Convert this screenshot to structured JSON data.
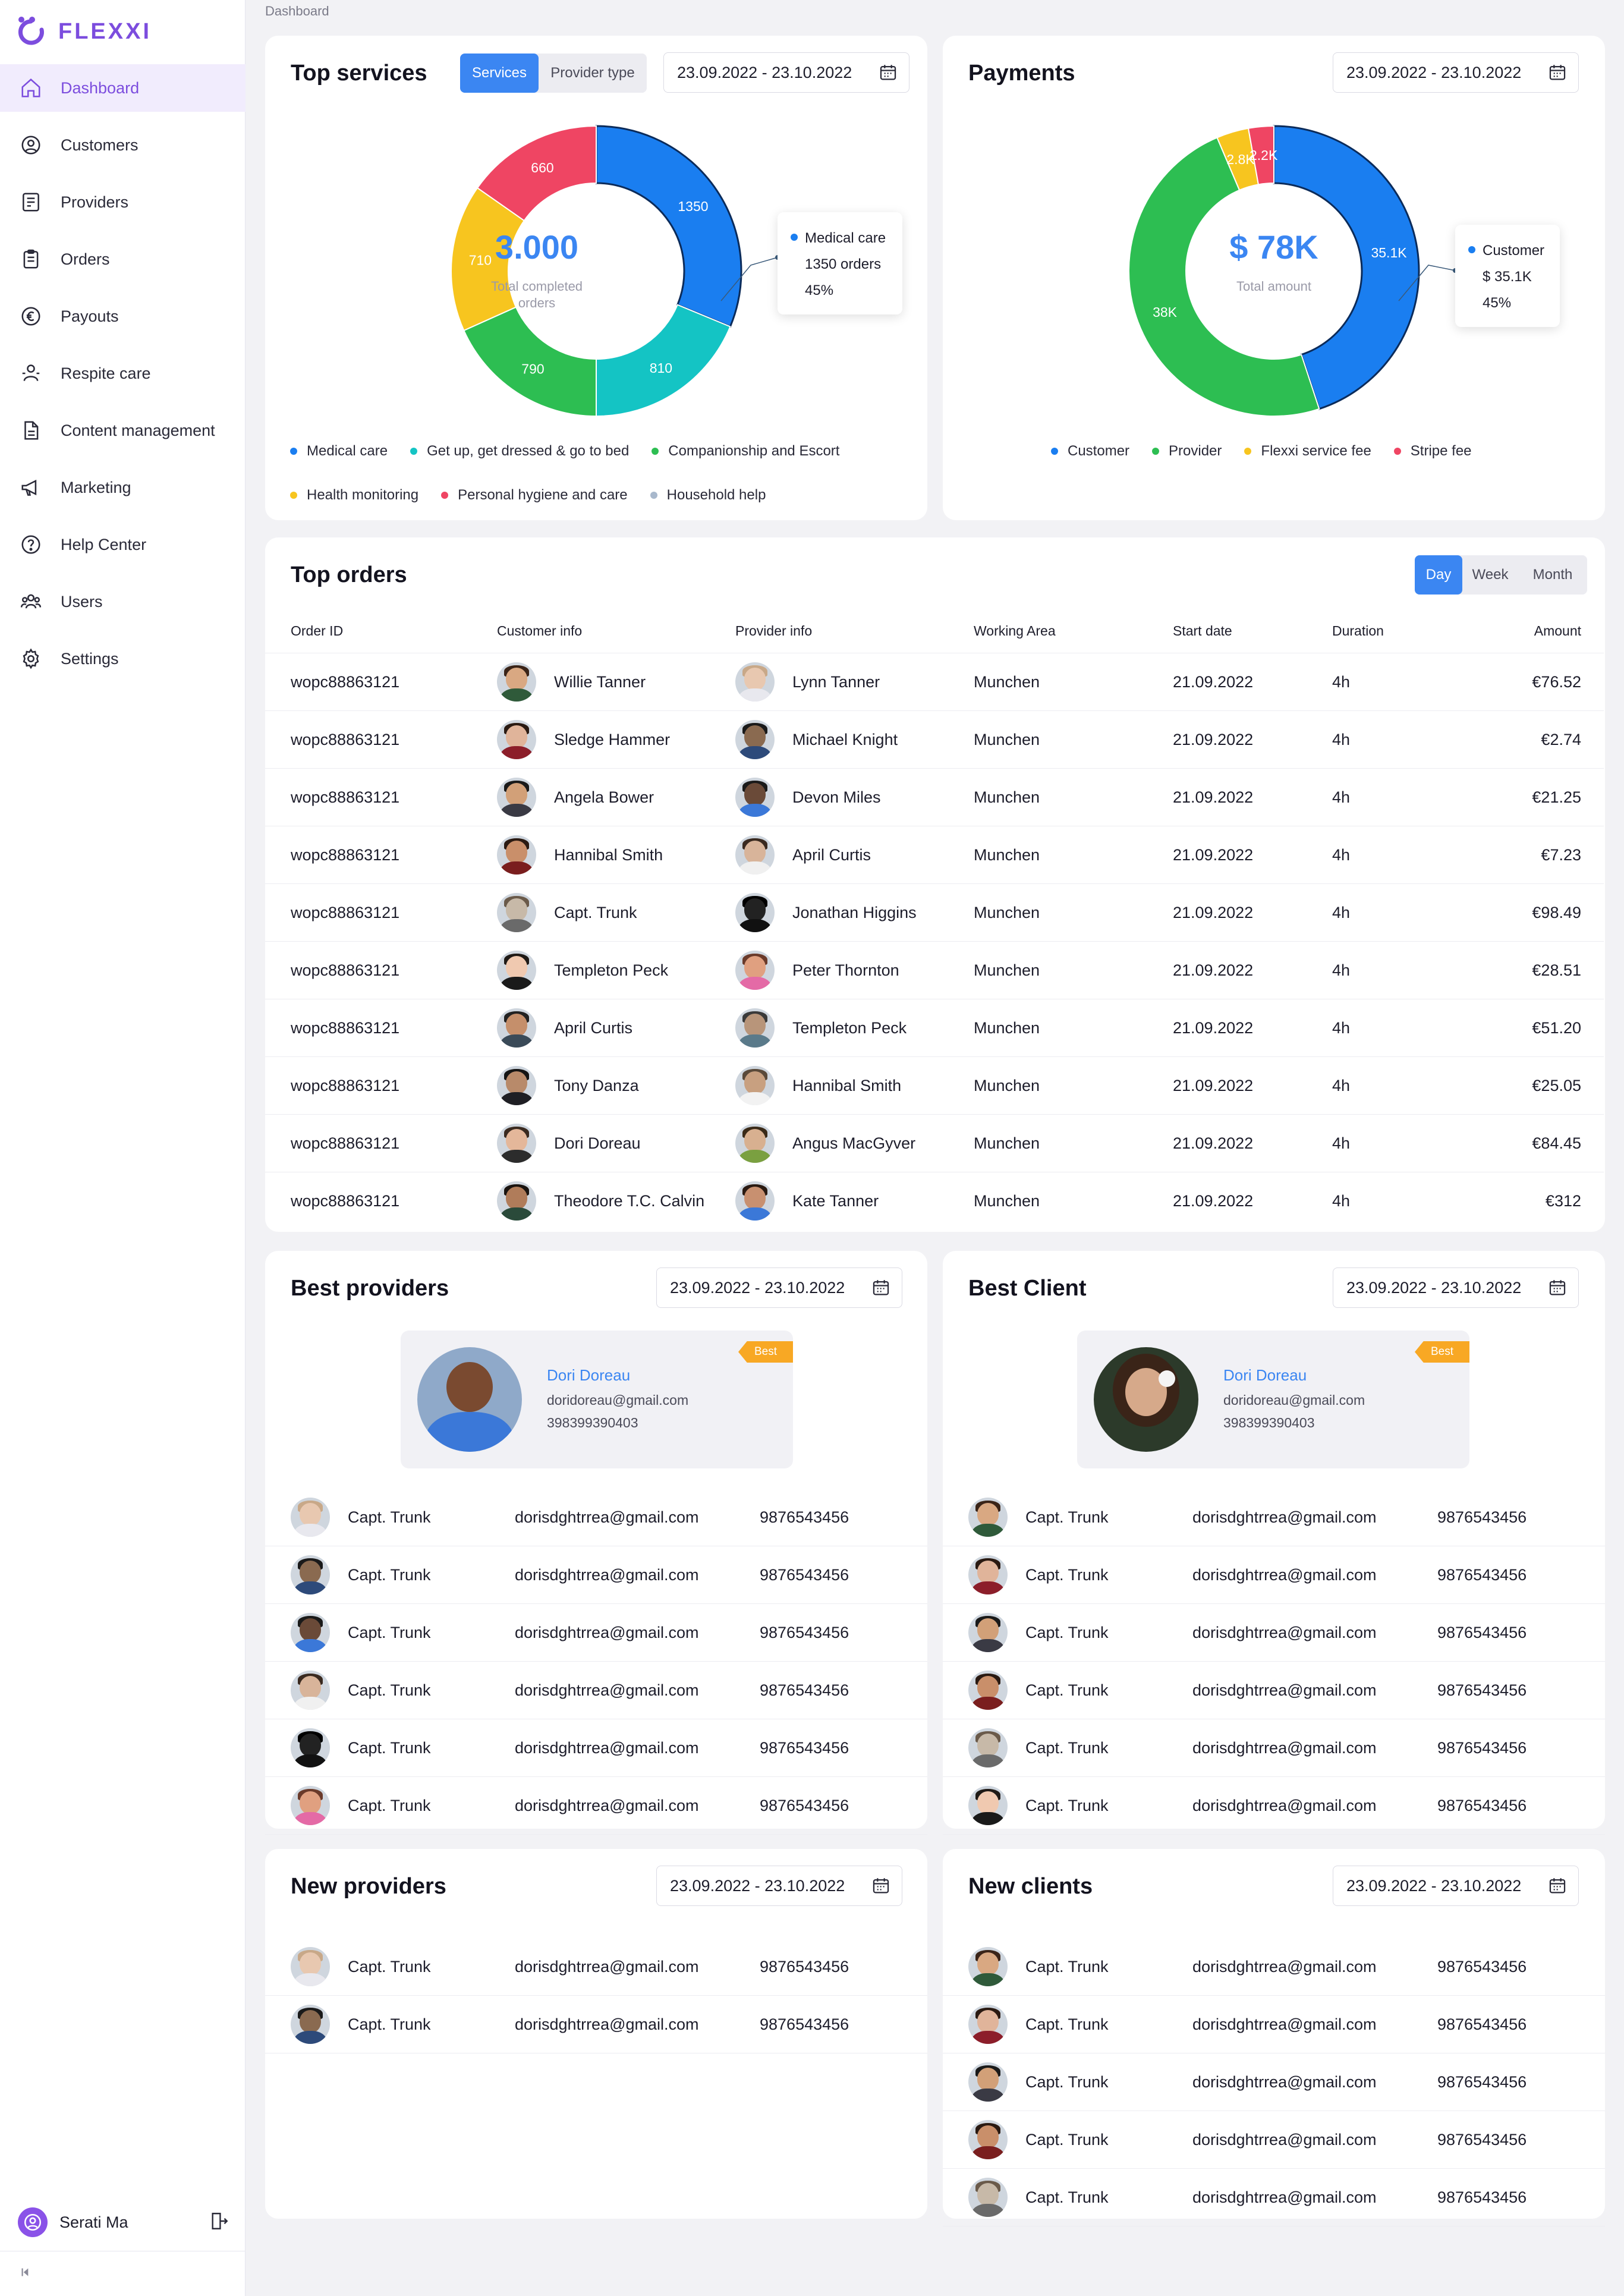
{
  "app": {
    "name": "FLEXXI"
  },
  "breadcrumb": "Dashboard",
  "sidebar": {
    "items": [
      {
        "label": "Dashboard",
        "icon": "home-icon"
      },
      {
        "label": "Customers",
        "icon": "user-circle-icon"
      },
      {
        "label": "Providers",
        "icon": "providers-icon"
      },
      {
        "label": "Orders",
        "icon": "clipboard-icon"
      },
      {
        "label": "Payouts",
        "icon": "euro-icon"
      },
      {
        "label": "Respite care",
        "icon": "respite-icon"
      },
      {
        "label": "Content management",
        "icon": "document-icon"
      },
      {
        "label": "Marketing",
        "icon": "megaphone-icon"
      },
      {
        "label": "Help Center",
        "icon": "help-icon"
      },
      {
        "label": "Users",
        "icon": "users-icon"
      },
      {
        "label": "Settings",
        "icon": "gear-icon"
      }
    ],
    "user_name": "Serati Ma"
  },
  "top_services": {
    "title": "Top services",
    "tabs": [
      "Services",
      "Provider type"
    ],
    "date_range": "23.09.2022 - 23.10.2022",
    "center_value": "3.000",
    "center_label_1": "Total completed",
    "center_label_2": "orders",
    "tooltip": {
      "line1": "Medical care",
      "line2": "1350 orders",
      "line3": "45%"
    },
    "legend": [
      {
        "label": "Medical care",
        "color": "#1a7ef0"
      },
      {
        "label": "Get up, get dressed & go to bed",
        "color": "#14c4c4"
      },
      {
        "label": "Companionship and Escort",
        "color": "#2dbe52"
      },
      {
        "label": "Health monitoring",
        "color": "#f7c51f"
      },
      {
        "label": "Personal hygiene and care",
        "color": "#ef4563"
      },
      {
        "label": "Household help",
        "color": "#a8b8cc"
      }
    ]
  },
  "payments": {
    "title": "Payments",
    "date_range": "23.09.2022 - 23.10.2022",
    "center_value": "$ 78K",
    "center_label": "Total amount",
    "tooltip": {
      "line1": "Customer",
      "line2": "$ 35.1K",
      "line3": "45%"
    },
    "legend": [
      {
        "label": "Customer",
        "color": "#1a7ef0"
      },
      {
        "label": "Provider",
        "color": "#2dbe52"
      },
      {
        "label": "Flexxi service fee",
        "color": "#f7c51f"
      },
      {
        "label": "Stripe fee",
        "color": "#ef4563"
      }
    ]
  },
  "chart_data": [
    {
      "type": "pie",
      "title": "Top services",
      "categories": [
        "Medical care",
        "Get up, get dressed & go to bed",
        "Companionship and Escort",
        "Health monitoring",
        "Personal hygiene and care"
      ],
      "values": [
        1350,
        810,
        790,
        710,
        660
      ],
      "labels": [
        "1350",
        "810",
        "790",
        "710",
        "660"
      ],
      "colors": [
        "#1a7ef0",
        "#14c4c4",
        "#2dbe52",
        "#f7c51f",
        "#ef4563"
      ]
    },
    {
      "type": "pie",
      "title": "Payments",
      "categories": [
        "Customer",
        "Provider",
        "Flexxi service fee",
        "Stripe fee"
      ],
      "values": [
        35.1,
        38,
        2.8,
        2.2
      ],
      "labels": [
        "35.1K",
        "38K",
        "2.8K",
        "2.2K"
      ],
      "colors": [
        "#1a7ef0",
        "#2dbe52",
        "#f7c51f",
        "#ef4563"
      ]
    }
  ],
  "top_orders": {
    "title": "Top orders",
    "periods": [
      "Day",
      "Week",
      "Month"
    ],
    "columns": [
      "Order ID",
      "Customer info",
      "Provider info",
      "Working Area",
      "Start date",
      "Duration",
      "Amount"
    ],
    "rows": [
      {
        "id": "wopc88863121",
        "customer": "Willie Tanner",
        "provider": "Lynn Tanner",
        "area": "Munchen",
        "start": "21.09.2022",
        "duration": "4h",
        "amount": "€76.52"
      },
      {
        "id": "wopc88863121",
        "customer": "Sledge Hammer",
        "provider": "Michael Knight",
        "area": "Munchen",
        "start": "21.09.2022",
        "duration": "4h",
        "amount": "€2.74"
      },
      {
        "id": "wopc88863121",
        "customer": "Angela Bower",
        "provider": "Devon Miles",
        "area": "Munchen",
        "start": "21.09.2022",
        "duration": "4h",
        "amount": "€21.25"
      },
      {
        "id": "wopc88863121",
        "customer": "Hannibal Smith",
        "provider": "April Curtis",
        "area": "Munchen",
        "start": "21.09.2022",
        "duration": "4h",
        "amount": "€7.23"
      },
      {
        "id": "wopc88863121",
        "customer": "Capt. Trunk",
        "provider": "Jonathan Higgins",
        "area": "Munchen",
        "start": "21.09.2022",
        "duration": "4h",
        "amount": "€98.49"
      },
      {
        "id": "wopc88863121",
        "customer": "Templeton Peck",
        "provider": "Peter Thornton",
        "area": "Munchen",
        "start": "21.09.2022",
        "duration": "4h",
        "amount": "€28.51"
      },
      {
        "id": "wopc88863121",
        "customer": "April Curtis",
        "provider": "Templeton Peck",
        "area": "Munchen",
        "start": "21.09.2022",
        "duration": "4h",
        "amount": "€51.20"
      },
      {
        "id": "wopc88863121",
        "customer": "Tony Danza",
        "provider": "Hannibal Smith",
        "area": "Munchen",
        "start": "21.09.2022",
        "duration": "4h",
        "amount": "€25.05"
      },
      {
        "id": "wopc88863121",
        "customer": "Dori Doreau",
        "provider": "Angus MacGyver",
        "area": "Munchen",
        "start": "21.09.2022",
        "duration": "4h",
        "amount": "€84.45"
      },
      {
        "id": "wopc88863121",
        "customer": "Theodore T.C. Calvin",
        "provider": "Kate Tanner",
        "area": "Munchen",
        "start": "21.09.2022",
        "duration": "4h",
        "amount": "€312"
      }
    ]
  },
  "best_providers": {
    "title": "Best providers",
    "date_range": "23.09.2022 - 23.10.2022",
    "best": {
      "name": "Dori Doreau",
      "email": "doridoreau@gmail.com",
      "phone": "398399390403",
      "badge": "Best"
    },
    "rows": [
      {
        "name": "Capt. Trunk",
        "email": "dorisdghtrrea@gmail.com",
        "phone": "9876543456"
      },
      {
        "name": "Capt. Trunk",
        "email": "dorisdghtrrea@gmail.com",
        "phone": "9876543456"
      },
      {
        "name": "Capt. Trunk",
        "email": "dorisdghtrrea@gmail.com",
        "phone": "9876543456"
      },
      {
        "name": "Capt. Trunk",
        "email": "dorisdghtrrea@gmail.com",
        "phone": "9876543456"
      },
      {
        "name": "Capt. Trunk",
        "email": "dorisdghtrrea@gmail.com",
        "phone": "9876543456"
      },
      {
        "name": "Capt. Trunk",
        "email": "dorisdghtrrea@gmail.com",
        "phone": "9876543456"
      }
    ]
  },
  "best_client": {
    "title": "Best Client",
    "date_range": "23.09.2022 - 23.10.2022",
    "best": {
      "name": "Dori Doreau",
      "email": "doridoreau@gmail.com",
      "phone": "398399390403",
      "badge": "Best"
    },
    "rows": [
      {
        "name": "Capt. Trunk",
        "email": "dorisdghtrrea@gmail.com",
        "phone": "9876543456"
      },
      {
        "name": "Capt. Trunk",
        "email": "dorisdghtrrea@gmail.com",
        "phone": "9876543456"
      },
      {
        "name": "Capt. Trunk",
        "email": "dorisdghtrrea@gmail.com",
        "phone": "9876543456"
      },
      {
        "name": "Capt. Trunk",
        "email": "dorisdghtrrea@gmail.com",
        "phone": "9876543456"
      },
      {
        "name": "Capt. Trunk",
        "email": "dorisdghtrrea@gmail.com",
        "phone": "9876543456"
      },
      {
        "name": "Capt. Trunk",
        "email": "dorisdghtrrea@gmail.com",
        "phone": "9876543456"
      }
    ]
  },
  "new_providers": {
    "title": "New providers",
    "date_range": "23.09.2022 - 23.10.2022",
    "rows": [
      {
        "name": "Capt. Trunk",
        "email": "dorisdghtrrea@gmail.com",
        "phone": "9876543456"
      },
      {
        "name": "Capt. Trunk",
        "email": "dorisdghtrrea@gmail.com",
        "phone": "9876543456"
      }
    ]
  },
  "new_clients": {
    "title": "New clients",
    "date_range": "23.09.2022 - 23.10.2022",
    "rows": [
      {
        "name": "Capt. Trunk",
        "email": "dorisdghtrrea@gmail.com",
        "phone": "9876543456"
      },
      {
        "name": "Capt. Trunk",
        "email": "dorisdghtrrea@gmail.com",
        "phone": "9876543456"
      },
      {
        "name": "Capt. Trunk",
        "email": "dorisdghtrrea@gmail.com",
        "phone": "9876543456"
      },
      {
        "name": "Capt. Trunk",
        "email": "dorisdghtrrea@gmail.com",
        "phone": "9876543456"
      },
      {
        "name": "Capt. Trunk",
        "email": "dorisdghtrrea@gmail.com",
        "phone": "9876543456"
      }
    ]
  },
  "colors": {
    "accent": "#7c4dde",
    "primary": "#3b86f2",
    "badge": "#f8a824"
  }
}
